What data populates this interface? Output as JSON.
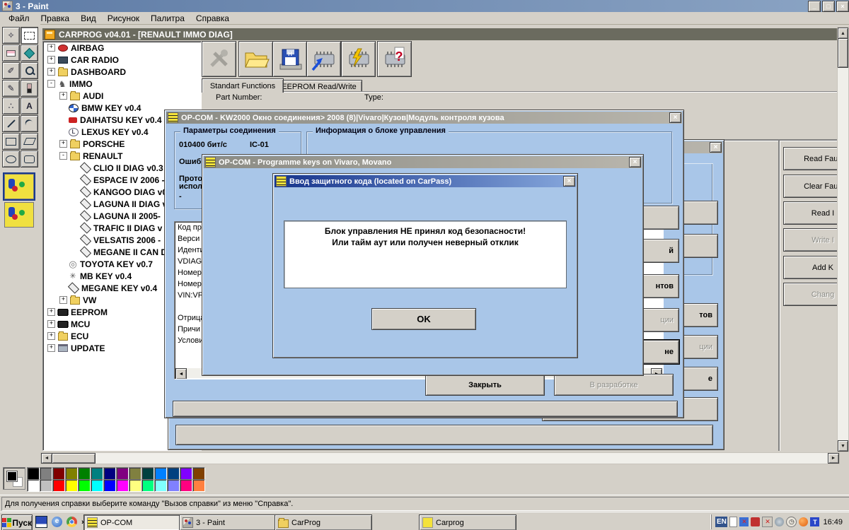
{
  "colors": {
    "window_gray": "#d4d0c8",
    "dialog_blue": "#a9c6e8",
    "opcom_yellow": "#f4e23a",
    "active_title": "#16348c",
    "carprog_title": "#6b6b5f"
  },
  "paint": {
    "title": "3 - Paint",
    "window_buttons": {
      "minimize": "_",
      "restore": "□",
      "close": "×"
    },
    "menu": [
      "Файл",
      "Правка",
      "Вид",
      "Рисунок",
      "Палитра",
      "Справка"
    ],
    "tools": [
      "freeform-select",
      "rect-select",
      "eraser",
      "fill",
      "color-picker",
      "magnifier",
      "pencil",
      "brush",
      "airbrush",
      "text",
      "line",
      "curve",
      "rectangle",
      "polygon",
      "ellipse",
      "rounded-rectangle"
    ],
    "palette_row1": [
      "#000000",
      "#808080",
      "#800000",
      "#808000",
      "#008000",
      "#008080",
      "#000080",
      "#800080",
      "#808040",
      "#004040",
      "#0080FF",
      "#004080",
      "#8000FF",
      "#804000"
    ],
    "palette_row2": [
      "#FFFFFF",
      "#C0C0C0",
      "#FF0000",
      "#FFFF00",
      "#00FF00",
      "#00FFFF",
      "#0000FF",
      "#FF00FF",
      "#FFFF80",
      "#00FF80",
      "#80FFFF",
      "#8080FF",
      "#FF0080",
      "#FF8040"
    ],
    "status": "Для получения справки выберите команду \"Вызов справки\" из меню \"Справка\"."
  },
  "carprog": {
    "title": "CARPROG  v04.01 - [RENAULT IMMO DIAG]",
    "toolbar_icons": [
      "settings-icon",
      "open-folder-icon",
      "save-icon",
      "chip-read-icon",
      "chip-program-icon",
      "chip-test-icon"
    ],
    "tabs": [
      "Standart Functions",
      "EEPROM Read/Write"
    ],
    "part_label": "Part Number:",
    "type_label": "Type:",
    "tree": [
      {
        "level": 0,
        "expand": "+",
        "icon": "airbag-pin",
        "label": "AIRBAG"
      },
      {
        "level": 0,
        "expand": "+",
        "icon": "radio",
        "label": "CAR RADIO"
      },
      {
        "level": 0,
        "expand": "+",
        "icon": "folder",
        "label": "DASHBOARD"
      },
      {
        "level": 0,
        "expand": "-",
        "icon": "immo",
        "label": "IMMO"
      },
      {
        "level": 1,
        "expand": "+",
        "icon": "folder",
        "label": "AUDI"
      },
      {
        "level": 1,
        "expand": null,
        "icon": "bmw",
        "label": "BMW KEY v0.4"
      },
      {
        "level": 1,
        "expand": null,
        "icon": "daihatsu",
        "label": "DAIHATSU KEY v0.4"
      },
      {
        "level": 1,
        "expand": null,
        "icon": "lexus",
        "label": "LEXUS KEY v0.4"
      },
      {
        "level": 1,
        "expand": "+",
        "icon": "folder",
        "label": "PORSCHE"
      },
      {
        "level": 1,
        "expand": "-",
        "icon": "folder",
        "label": "RENAULT"
      },
      {
        "level": 2,
        "expand": null,
        "icon": "renault",
        "label": "CLIO II DIAG v0.3"
      },
      {
        "level": 2,
        "expand": null,
        "icon": "renault",
        "label": "ESPACE IV 2006 -"
      },
      {
        "level": 2,
        "expand": null,
        "icon": "renault",
        "label": "KANGOO DIAG v0"
      },
      {
        "level": 2,
        "expand": null,
        "icon": "renault",
        "label": "LAGUNA II DIAG v"
      },
      {
        "level": 2,
        "expand": null,
        "icon": "renault",
        "label": "LAGUNA II 2005-"
      },
      {
        "level": 2,
        "expand": null,
        "icon": "renault",
        "label": "TRAFIC II DIAG v"
      },
      {
        "level": 2,
        "expand": null,
        "icon": "renault",
        "label": "VELSATIS 2006 -"
      },
      {
        "level": 2,
        "expand": null,
        "icon": "renault",
        "label": "MEGANE II CAN D"
      },
      {
        "level": 1,
        "expand": null,
        "icon": "toyota",
        "label": "TOYOTA KEY v0.7"
      },
      {
        "level": 1,
        "expand": null,
        "icon": "mercedes",
        "label": "MB KEY v0.4"
      },
      {
        "level": 1,
        "expand": null,
        "icon": "renault",
        "label": "MEGANE KEY v0.4"
      },
      {
        "level": 1,
        "expand": "+",
        "icon": "folder",
        "label": "VW"
      },
      {
        "level": 0,
        "expand": "+",
        "icon": "chip",
        "label": "EEPROM"
      },
      {
        "level": 0,
        "expand": "+",
        "icon": "chip",
        "label": "MCU"
      },
      {
        "level": 0,
        "expand": "+",
        "icon": "folder",
        "label": "ECU"
      },
      {
        "level": 0,
        "expand": "+",
        "icon": "update",
        "label": "UPDATE"
      }
    ]
  },
  "fault_panel": {
    "buttons": [
      {
        "label": "Read Fault",
        "style": ""
      },
      {
        "label": "Clear Fault",
        "style": ""
      },
      {
        "label": "Read I",
        "style": ""
      },
      {
        "label": "Write I",
        "style": "disabled"
      },
      {
        "label": "Add K",
        "style": ""
      },
      {
        "label": "Chang",
        "style": "disabled"
      }
    ]
  },
  "kw2000": {
    "title": "OP-COM - KW2000 Окно соединения> 2008 (8)|Vivaro|Кузов|Модуль контроля кузова",
    "close_x": "×",
    "group_connection": "Параметры соединения",
    "group_ecu": "Информация о блоке управления",
    "conn_speed": "010400 бит/с",
    "conn_id": "IC-01",
    "conn_l2": "Ошиб",
    "conn_l3": "Прото",
    "conn_l4": "испол",
    "conn_l5": "-",
    "info_list": [
      "Код пр",
      "Верси",
      "Иденти",
      "VDIAG",
      "Номер",
      "Номер",
      "VIN:VF",
      "",
      "Отрица",
      "Причи",
      "Услови"
    ],
    "side_buttons": [
      {
        "label": "",
        "style": ""
      },
      {
        "label": "й",
        "style": "bold"
      },
      {
        "label": "нтов",
        "style": "bold"
      },
      {
        "label": "ции",
        "style": "disabled"
      },
      {
        "label": "не",
        "style": "bold default"
      }
    ],
    "close_button": "Закрыть",
    "dev_button": "В разработке"
  },
  "midwin": {
    "close_x": "×",
    "side_buttons": [
      {
        "label": "",
        "style": ""
      },
      {
        "label": "",
        "style": ""
      },
      {
        "label": "тов",
        "style": "bold"
      },
      {
        "label": "ции",
        "style": "disabled"
      },
      {
        "label": "е",
        "style": "bold"
      },
      {
        "label": "",
        "style": ""
      }
    ]
  },
  "keyswin": {
    "title": "OP-COM - Programme keys on Vivaro, Movano",
    "close_x": "×"
  },
  "dialog": {
    "title": "Ввод защитного кода (located on CarPass)",
    "close_x": "×",
    "line1": "Блок управления НЕ принял код безопасности!",
    "line2": "Или тайм аут или получен неверный отклик",
    "ok": "OK"
  },
  "taskbar": {
    "start_label": "Пуск",
    "quicklaunch": [
      "floppy-icon",
      "ie-icon",
      "chrome-icon"
    ],
    "overflow_chevron": "»",
    "buttons": [
      {
        "icon": "opcom",
        "label": "OP-COM",
        "active": true
      },
      {
        "icon": "paint",
        "label": "3 - Paint",
        "active": false
      },
      {
        "icon": "folder",
        "label": "CarProg",
        "active": false
      },
      {
        "icon": "carprog",
        "label": "Carprog",
        "active": false
      }
    ],
    "tray": {
      "lang": "EN",
      "icons": [
        "battery-icon",
        "monitor-error-icon",
        "ati-icon",
        "printer-error-icon",
        "globe-icon",
        "clock-icon",
        "orange-ball-icon",
        "tuner-icon"
      ],
      "time": "16:49"
    }
  }
}
